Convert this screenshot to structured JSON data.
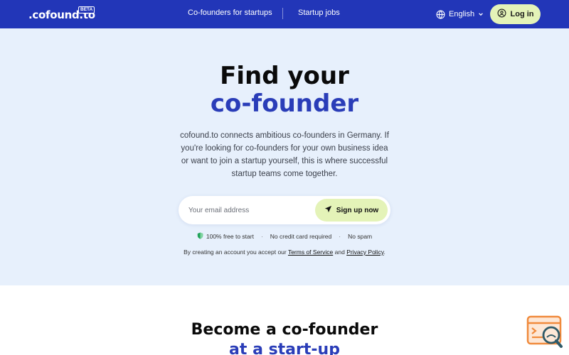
{
  "header": {
    "logo_text": ".cofound.to",
    "logo_badge": "BETA",
    "nav": {
      "cofounders": "Co-founders for startups",
      "jobs": "Startup jobs"
    },
    "language": "English",
    "login": "Log in",
    "icons": {
      "language": "globe-icon",
      "language_caret": "chevron-down-icon",
      "login": "user-circle-icon"
    }
  },
  "hero": {
    "title_line1": "Find your",
    "title_line2": "co-founder",
    "description": "cofound.to connects ambitious co-founders in Germany. If you're looking for co-founders for your own business idea or want to join a startup yourself, this is where successful startup teams come together.",
    "email_placeholder": "Your email address",
    "signup_label": "Sign up now",
    "features": [
      "100% free to start",
      "No credit card required",
      "No spam"
    ],
    "features_separator": "·",
    "terms_prefix": "By creating an account you accept our",
    "terms_link": "Terms of Service",
    "terms_and": "and",
    "privacy_link": "Privacy Policy",
    "terms_suffix": "."
  },
  "section2": {
    "title_line1": "Become a co-founder",
    "title_line2": "at a start-up"
  },
  "colors": {
    "header_bg": "#2236b8",
    "accent_blue": "#2a3db8",
    "hero_bg": "#e7f0fc",
    "button_lime": "#e4f3b8",
    "shield_green": "#22a35a"
  }
}
